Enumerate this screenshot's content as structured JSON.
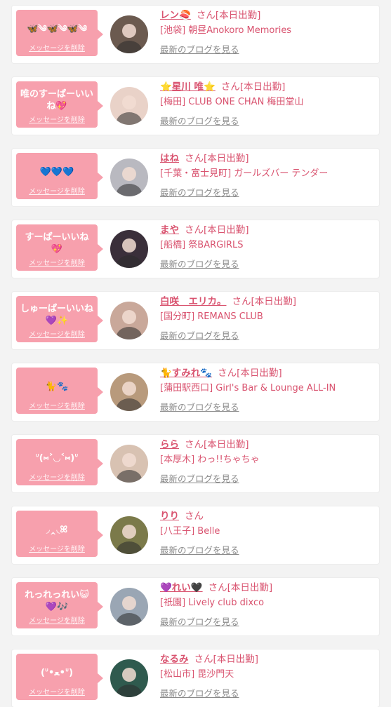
{
  "theme": {
    "accent": "#d9536f",
    "bubble": "#f7a0ad",
    "background": "#f3f3f3"
  },
  "delete_label": "メッセージを削除",
  "blog_label": "最新のブログを見る",
  "suffix": "さん",
  "items": [
    {
      "message": "🦋༄🦋༄🦋༄",
      "name": "レン🍣",
      "shift": "[本日出勤]",
      "shop": "[池袋] 朝昼Anokoro Memories",
      "avatar_color": "#6b5a4f",
      "avatar_icon": "person-photo"
    },
    {
      "message": "唯のすーぱーいいね💖",
      "name": "⭐星川 唯⭐",
      "shift": "[本日出勤]",
      "shop": "[梅田] CLUB ONE CHAN 梅田堂山",
      "avatar_color": "#e9d2c8",
      "avatar_icon": "person-photo"
    },
    {
      "message": "💙💙💙",
      "name": "はね",
      "shift": "[本日出勤]",
      "shop": "[千葉・富士見町] ガールズバー テンダー",
      "avatar_color": "#b9b9c0",
      "avatar_icon": "person-photo"
    },
    {
      "message": "すーぱーいいね💖",
      "name": "まや",
      "shift": "[本日出勤]",
      "shop": "[船橋] 祭BARGIRLS",
      "avatar_color": "#3a2f3a",
      "avatar_icon": "person-photo"
    },
    {
      "message": "しゅーぱーいいね💜✨",
      "name": "白咲　エリカ。",
      "shift": "[本日出勤]",
      "shop": "[国分町] REMANS CLUB",
      "avatar_color": "#c9a89a",
      "avatar_icon": "person-photo"
    },
    {
      "message": "🐈🐾",
      "name": "🐈すみれ🐾",
      "shift": "[本日出勤]",
      "shop": "[蒲田駅西口] Girl's Bar & Lounge ALL-IN",
      "avatar_color": "#b89a7c",
      "avatar_icon": "person-photo"
    },
    {
      "message": "ᐡ(⑅˃◡˂⑅)ᐡ",
      "name": "らら",
      "shift": "[本日出勤]",
      "shop": "[本厚木] わっ!!ちゃちゃ",
      "avatar_color": "#d8c2b2",
      "avatar_icon": "person-photo"
    },
    {
      "message": "◞‸◟ꕤ",
      "name": "りり",
      "shift": "",
      "shop": "[八王子] Belle",
      "avatar_color": "#7b7a4a",
      "avatar_icon": "person-photo"
    },
    {
      "message": "れっれっれい😺💜🎶",
      "name": "💜れい🖤",
      "shift": "[本日出勤]",
      "shop": "[祇園] Lively club dixco",
      "avatar_color": "#9aa6b4",
      "avatar_icon": "person-photo"
    },
    {
      "message": "(ᐡ•ﻌ•ᐡ)",
      "name": "なるみ",
      "shift": "[本日出勤]",
      "shop": "[松山市] 毘沙門天",
      "avatar_color": "#2f5a4e",
      "avatar_icon": "person-photo"
    }
  ]
}
